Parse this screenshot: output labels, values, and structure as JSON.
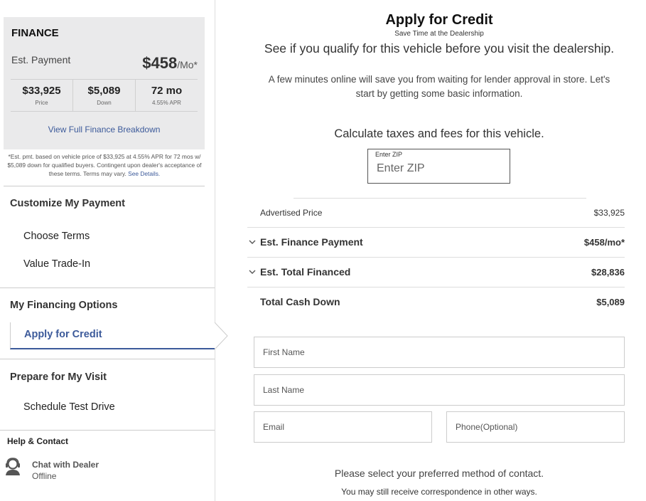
{
  "finance": {
    "title": "FINANCE",
    "est_label": "Est. Payment",
    "amount": "$458",
    "amount_unit": "/Mo*",
    "stats": [
      {
        "value": "$33,925",
        "sub": "Price"
      },
      {
        "value": "$5,089",
        "sub": "Down"
      },
      {
        "value": "72 mo",
        "sub": "4.55% APR"
      }
    ],
    "breakdown_link": "View Full Finance Breakdown",
    "disclaimer": "*Est. pmt. based on vehicle price of $33,925 at 4.55% APR for 72 mos w/ $5,089 down for qualified buyers. Contingent upon dealer's acceptance of these terms. Terms may vary.",
    "disclaimer_link": "See Details."
  },
  "sidebar": {
    "customize": {
      "heading": "Customize My Payment",
      "items": [
        "Choose Terms",
        "Value Trade-In"
      ]
    },
    "financing": {
      "heading": "My Financing Options",
      "active_item": "Apply for Credit"
    },
    "visit": {
      "heading": "Prepare for My Visit",
      "items": [
        "Schedule Test Drive"
      ]
    },
    "help": {
      "heading": "Help & Contact",
      "chat_name": "Chat with Dealer",
      "chat_status": "Offline"
    }
  },
  "main": {
    "title": "Apply for Credit",
    "subtitle": "Save Time at the Dealership",
    "lead": "See if you qualify for this vehicle before you visit the dealership.",
    "intro": "A few minutes online will save you from waiting for lender approval in store. Let's start by getting some basic information.",
    "calc_heading": "Calculate taxes and fees for this vehicle.",
    "zip": {
      "label": "Enter ZIP",
      "placeholder": "Enter ZIP"
    },
    "summary": [
      {
        "label": "Advertised Price",
        "value": "$33,925"
      },
      {
        "label": "Est. Finance Payment",
        "value": "$458/mo*"
      },
      {
        "label": "Est. Total Financed",
        "value": "$28,836"
      },
      {
        "label": "Total Cash Down",
        "value": "$5,089"
      }
    ],
    "form": {
      "first_name": "First Name",
      "last_name": "Last Name",
      "email": "Email",
      "phone": "Phone(Optional)"
    },
    "contact_question": "Please select your preferred method of contact.",
    "contact_note": "You may still receive correspondence in other ways."
  },
  "colors": {
    "accent": "#3c5a9a",
    "card_bg": "#eaeaeb"
  }
}
